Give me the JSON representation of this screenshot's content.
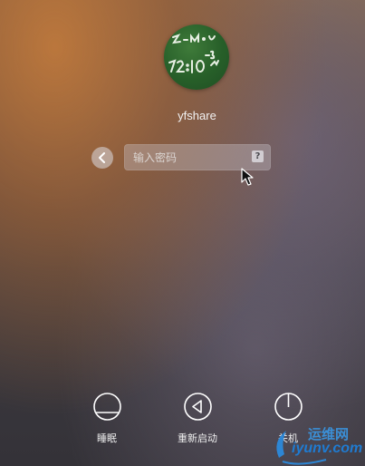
{
  "login": {
    "avatar_icon": "chalkboard-avatar-icon",
    "username": "yfshare",
    "password_placeholder": "输入密码",
    "help_label": "?",
    "back_icon": "chevron-left-icon"
  },
  "actions": [
    {
      "label": "睡眠",
      "icon": "sleep-icon"
    },
    {
      "label": "重新启动",
      "icon": "restart-icon"
    },
    {
      "label": "关机",
      "icon": "power-icon"
    }
  ],
  "watermark": {
    "title": "运维网",
    "url": "iyunv.com"
  },
  "colors": {
    "icon_stroke": "#ffffff",
    "watermark_blue": "#1f7bd1"
  }
}
